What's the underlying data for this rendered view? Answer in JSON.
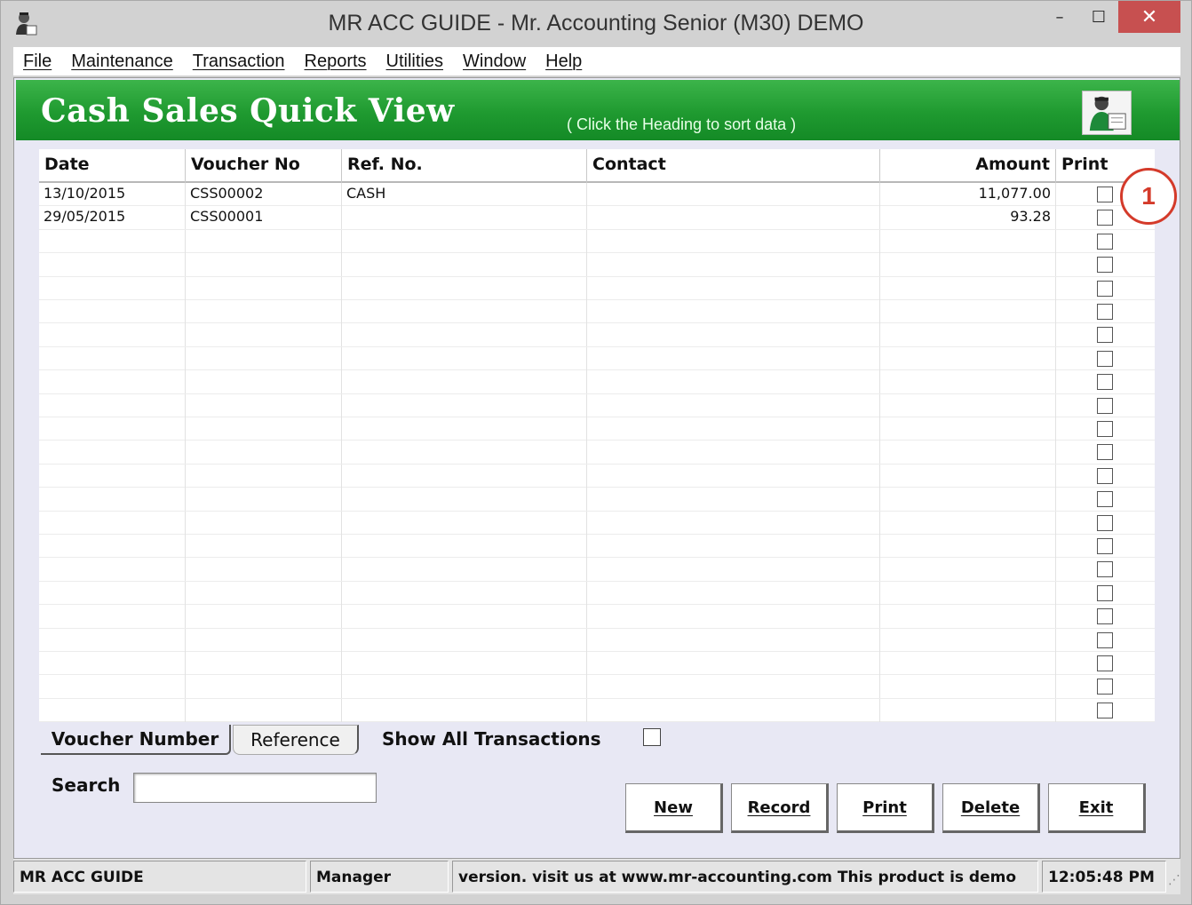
{
  "window": {
    "title": "MR ACC GUIDE - Mr. Accounting Senior (M30) DEMO",
    "icon": "app-user-icon",
    "controls": {
      "minimize": "–",
      "maximize": "☐",
      "close": "✕"
    }
  },
  "menu": [
    "File",
    "Maintenance",
    "Transaction",
    "Reports",
    "Utilities",
    "Window",
    "Help"
  ],
  "banner": {
    "title": "Cash Sales Quick View",
    "hint": "( Click the Heading to sort data )",
    "logo": "user-document-icon",
    "color": "#1f9a30"
  },
  "grid": {
    "columns": [
      "Date",
      "Voucher No",
      "Ref. No.",
      "Contact",
      "Amount",
      "Print"
    ],
    "rows": [
      {
        "date": "13/10/2015",
        "voucher": "CSS00002",
        "ref": "CASH",
        "contact": "",
        "amount": "11,077.00",
        "print": false
      },
      {
        "date": "29/05/2015",
        "voucher": "CSS00001",
        "ref": "",
        "contact": "",
        "amount": "93.28",
        "print": false
      },
      {
        "date": "",
        "voucher": "",
        "ref": "",
        "contact": "",
        "amount": "",
        "print": false
      },
      {
        "date": "",
        "voucher": "",
        "ref": "",
        "contact": "",
        "amount": "",
        "print": false
      },
      {
        "date": "",
        "voucher": "",
        "ref": "",
        "contact": "",
        "amount": "",
        "print": false
      },
      {
        "date": "",
        "voucher": "",
        "ref": "",
        "contact": "",
        "amount": "",
        "print": false
      },
      {
        "date": "",
        "voucher": "",
        "ref": "",
        "contact": "",
        "amount": "",
        "print": false
      },
      {
        "date": "",
        "voucher": "",
        "ref": "",
        "contact": "",
        "amount": "",
        "print": false
      },
      {
        "date": "",
        "voucher": "",
        "ref": "",
        "contact": "",
        "amount": "",
        "print": false
      },
      {
        "date": "",
        "voucher": "",
        "ref": "",
        "contact": "",
        "amount": "",
        "print": false
      },
      {
        "date": "",
        "voucher": "",
        "ref": "",
        "contact": "",
        "amount": "",
        "print": false
      },
      {
        "date": "",
        "voucher": "",
        "ref": "",
        "contact": "",
        "amount": "",
        "print": false
      },
      {
        "date": "",
        "voucher": "",
        "ref": "",
        "contact": "",
        "amount": "",
        "print": false
      },
      {
        "date": "",
        "voucher": "",
        "ref": "",
        "contact": "",
        "amount": "",
        "print": false
      },
      {
        "date": "",
        "voucher": "",
        "ref": "",
        "contact": "",
        "amount": "",
        "print": false
      },
      {
        "date": "",
        "voucher": "",
        "ref": "",
        "contact": "",
        "amount": "",
        "print": false
      },
      {
        "date": "",
        "voucher": "",
        "ref": "",
        "contact": "",
        "amount": "",
        "print": false
      },
      {
        "date": "",
        "voucher": "",
        "ref": "",
        "contact": "",
        "amount": "",
        "print": false
      },
      {
        "date": "",
        "voucher": "",
        "ref": "",
        "contact": "",
        "amount": "",
        "print": false
      },
      {
        "date": "",
        "voucher": "",
        "ref": "",
        "contact": "",
        "amount": "",
        "print": false
      },
      {
        "date": "",
        "voucher": "",
        "ref": "",
        "contact": "",
        "amount": "",
        "print": false
      },
      {
        "date": "",
        "voucher": "",
        "ref": "",
        "contact": "",
        "amount": "",
        "print": false
      },
      {
        "date": "",
        "voucher": "",
        "ref": "",
        "contact": "",
        "amount": "",
        "print": false
      }
    ]
  },
  "annotation": {
    "label": "1",
    "color": "#d43a2a"
  },
  "sort_tabs": {
    "voucher": "Voucher Number",
    "reference": "Reference"
  },
  "show_all": {
    "label": "Show All Transactions",
    "checked": false
  },
  "search": {
    "label": "Search",
    "value": ""
  },
  "buttons": {
    "new": "New",
    "record": "Record",
    "print": "Print",
    "delete": "Delete",
    "exit": "Exit"
  },
  "status": {
    "app": "MR ACC GUIDE",
    "user": "Manager",
    "message": "version.  visit us at www.mr-accounting.com This product is demo",
    "time": "12:05:48 PM"
  }
}
